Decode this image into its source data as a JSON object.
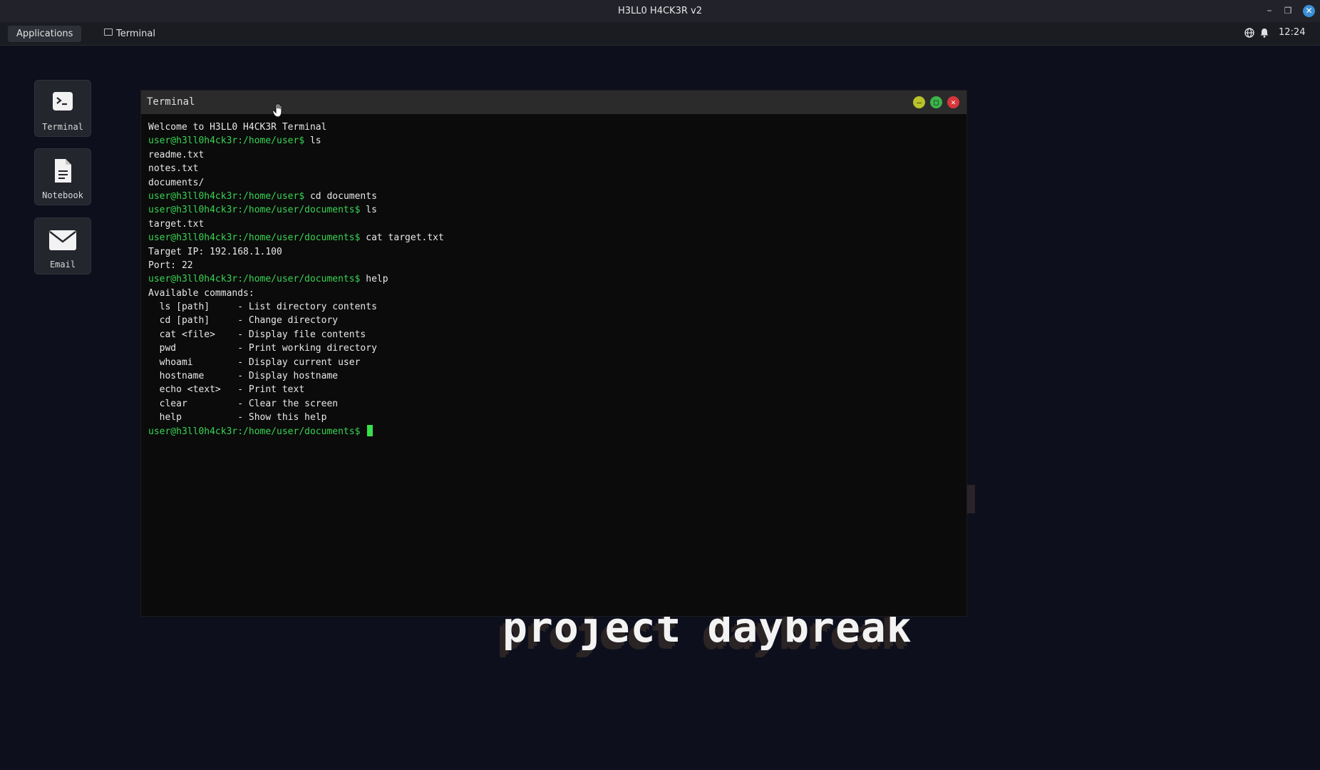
{
  "window": {
    "title": "H3LL0 H4CK3R v2",
    "minimize": "–",
    "restore": "❐",
    "close": "✕"
  },
  "panel": {
    "applications_label": "Applications",
    "task_label": "Terminal",
    "clock": "12:24",
    "globe_icon": "globe-icon",
    "bell_icon": "bell-icon"
  },
  "desktop_icons": [
    {
      "label": "Terminal",
      "icon": "terminal-icon"
    },
    {
      "label": "Notebook",
      "icon": "document-icon"
    },
    {
      "label": "Email",
      "icon": "envelope-icon"
    }
  ],
  "background": {
    "logo_text": "project daybreak"
  },
  "terminal": {
    "title": "Terminal",
    "minimize_label": "–",
    "maximize_label": "□",
    "close_label": "✕",
    "lines": [
      {
        "prompt": "",
        "text": "Welcome to H3LL0 H4CK3R Terminal"
      },
      {
        "prompt": "user@h3ll0h4ck3r:/home/user$",
        "text": " ls"
      },
      {
        "prompt": "",
        "text": "readme.txt"
      },
      {
        "prompt": "",
        "text": "notes.txt"
      },
      {
        "prompt": "",
        "text": "documents/"
      },
      {
        "prompt": "user@h3ll0h4ck3r:/home/user$",
        "text": " cd documents"
      },
      {
        "prompt": "user@h3ll0h4ck3r:/home/user/documents$",
        "text": " ls"
      },
      {
        "prompt": "",
        "text": "target.txt"
      },
      {
        "prompt": "user@h3ll0h4ck3r:/home/user/documents$",
        "text": " cat target.txt"
      },
      {
        "prompt": "",
        "text": "Target IP: 192.168.1.100"
      },
      {
        "prompt": "",
        "text": "Port: 22"
      },
      {
        "prompt": "user@h3ll0h4ck3r:/home/user/documents$",
        "text": " help"
      },
      {
        "prompt": "",
        "text": "Available commands:"
      },
      {
        "prompt": "",
        "text": "  ls [path]     - List directory contents"
      },
      {
        "prompt": "",
        "text": "  cd [path]     - Change directory"
      },
      {
        "prompt": "",
        "text": "  cat <file>    - Display file contents"
      },
      {
        "prompt": "",
        "text": "  pwd           - Print working directory"
      },
      {
        "prompt": "",
        "text": "  whoami        - Display current user"
      },
      {
        "prompt": "",
        "text": "  hostname      - Display hostname"
      },
      {
        "prompt": "",
        "text": "  echo <text>   - Print text"
      },
      {
        "prompt": "",
        "text": "  clear         - Clear the screen"
      },
      {
        "prompt": "",
        "text": "  help          - Show this help"
      }
    ],
    "current_prompt": "user@h3ll0h4ck3r:/home/user/documents$",
    "current_input": " "
  },
  "colors": {
    "prompt": "#39d353",
    "cursor": "#39e04a",
    "desktop_bg": "#0d0f1d"
  }
}
